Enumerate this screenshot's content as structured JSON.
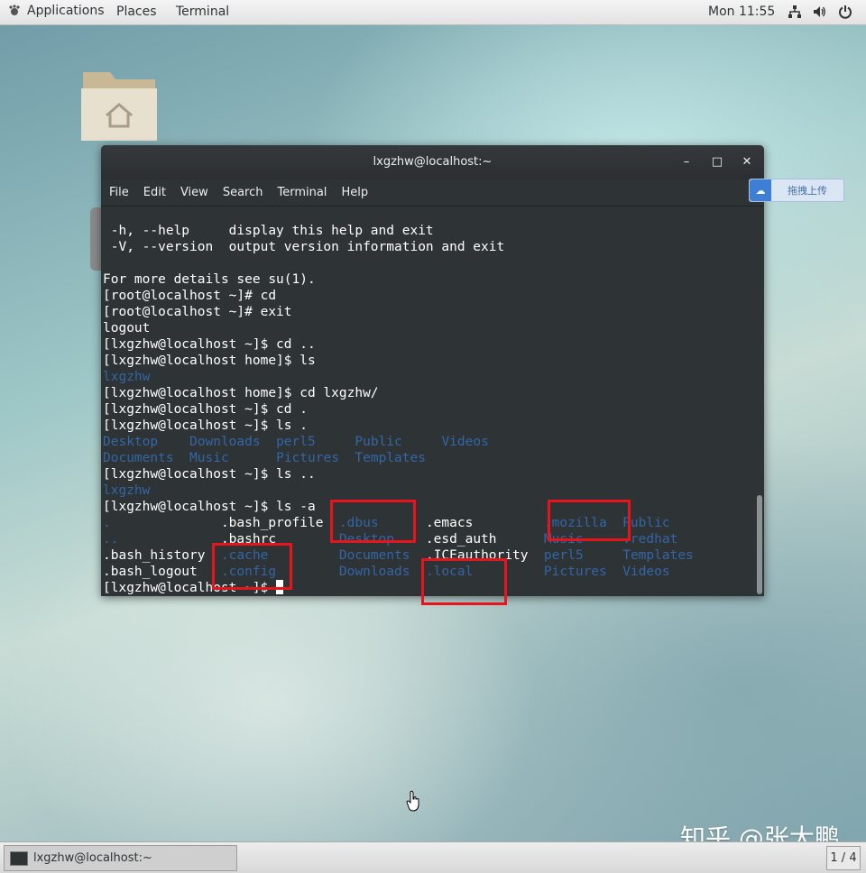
{
  "topbar": {
    "applications": "Applications",
    "places": "Places",
    "terminal": "Terminal",
    "clock": "Mon 11:55",
    "icons": [
      "network-icon",
      "volume-icon",
      "power-icon"
    ]
  },
  "window": {
    "title": "lxgzhw@localhost:~",
    "menu": [
      "File",
      "Edit",
      "View",
      "Search",
      "Terminal",
      "Help"
    ]
  },
  "upload_button": {
    "label": "拖拽上传"
  },
  "terminal": {
    "lines": [
      [
        {
          "t": " -h, --help     display this help and exit"
        }
      ],
      [
        {
          "t": " -V, --version  output version information and exit"
        }
      ],
      [
        {
          "t": ""
        }
      ],
      [
        {
          "t": "For more details see su(1)."
        }
      ],
      [
        {
          "t": "[root@localhost ~]# cd"
        }
      ],
      [
        {
          "t": "[root@localhost ~]# exit"
        }
      ],
      [
        {
          "t": "logout"
        }
      ],
      [
        {
          "t": "[lxgzhw@localhost ~]$ cd .."
        }
      ],
      [
        {
          "t": "[lxgzhw@localhost home]$ ls"
        }
      ],
      [
        {
          "t": "lxgzhw",
          "c": "blue"
        }
      ],
      [
        {
          "t": "[lxgzhw@localhost home]$ cd lxgzhw/"
        }
      ],
      [
        {
          "t": "[lxgzhw@localhost ~]$ cd ."
        }
      ],
      [
        {
          "t": "[lxgzhw@localhost ~]$ ls ."
        }
      ],
      [
        {
          "t": "Desktop",
          "c": "blue"
        },
        {
          "t": "    "
        },
        {
          "t": "Downloads",
          "c": "blue"
        },
        {
          "t": "  "
        },
        {
          "t": "perl5",
          "c": "blue"
        },
        {
          "t": "     "
        },
        {
          "t": "Public",
          "c": "blue"
        },
        {
          "t": "     "
        },
        {
          "t": "Videos",
          "c": "blue"
        }
      ],
      [
        {
          "t": "Documents",
          "c": "blue"
        },
        {
          "t": "  "
        },
        {
          "t": "Music",
          "c": "blue"
        },
        {
          "t": "      "
        },
        {
          "t": "Pictures",
          "c": "blue"
        },
        {
          "t": "  "
        },
        {
          "t": "Templates",
          "c": "blue"
        }
      ],
      [
        {
          "t": "[lxgzhw@localhost ~]$ ls .."
        }
      ],
      [
        {
          "t": "lxgzhw",
          "c": "blue"
        }
      ],
      [
        {
          "t": "[lxgzhw@localhost ~]$ ls -a"
        }
      ],
      [
        {
          "t": ".",
          "c": "blue"
        },
        {
          "t": "              .bash_profile  "
        },
        {
          "t": ".dbus",
          "c": "blue"
        },
        {
          "t": "      .emacs         "
        },
        {
          "t": ".mozilla",
          "c": "blue"
        },
        {
          "t": "  "
        },
        {
          "t": "Public",
          "c": "blue"
        }
      ],
      [
        {
          "t": "..",
          "c": "blue"
        },
        {
          "t": "             .bashrc        "
        },
        {
          "t": "Desktop",
          "c": "blue"
        },
        {
          "t": "    .esd_auth      "
        },
        {
          "t": "Music",
          "c": "blue"
        },
        {
          "t": "     "
        },
        {
          "t": ".redhat",
          "c": "blue"
        }
      ],
      [
        {
          "t": ".bash_history  "
        },
        {
          "t": ".cache",
          "c": "blue"
        },
        {
          "t": "         "
        },
        {
          "t": "Documents",
          "c": "blue"
        },
        {
          "t": "  .ICEauthority  "
        },
        {
          "t": "perl5",
          "c": "blue"
        },
        {
          "t": "     "
        },
        {
          "t": "Templates",
          "c": "blue"
        }
      ],
      [
        {
          "t": ".bash_logout   "
        },
        {
          "t": ".config",
          "c": "blue"
        },
        {
          "t": "        "
        },
        {
          "t": "Downloads",
          "c": "blue"
        },
        {
          "t": "  "
        },
        {
          "t": ".local",
          "c": "blue"
        },
        {
          "t": "         "
        },
        {
          "t": "Pictures",
          "c": "blue"
        },
        {
          "t": "  "
        },
        {
          "t": "Videos",
          "c": "blue"
        }
      ],
      [
        {
          "t": "[lxgzhw@localhost ~]$ "
        }
      ]
    ]
  },
  "taskbar": {
    "task_label": "lxgzhw@localhost:~",
    "pager": "1 / 4"
  },
  "watermark": "知乎 @张大鹏"
}
